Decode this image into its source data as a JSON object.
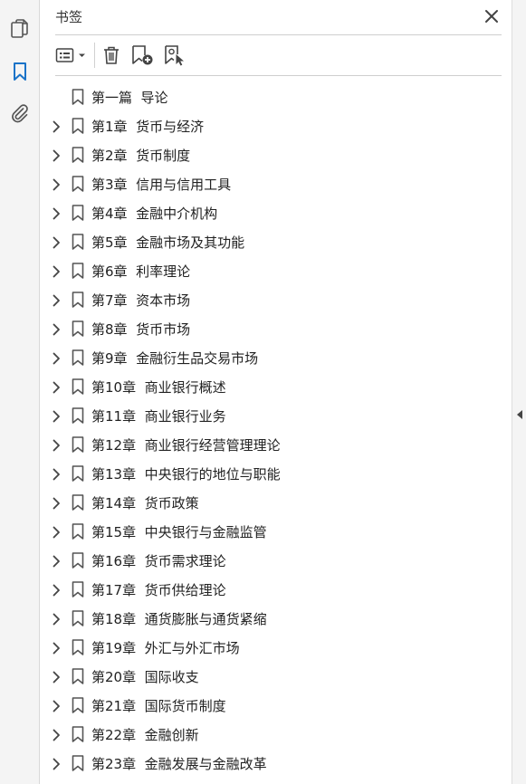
{
  "panel": {
    "title": "书签"
  },
  "rail": {
    "icons": [
      "pages-icon",
      "bookmark-icon",
      "attachment-icon"
    ],
    "active": "bookmark-icon"
  },
  "toolbar": {
    "buttons": [
      "options-menu-icon",
      "delete-bookmark-icon",
      "new-bookmark-icon",
      "new-bookmark-from-structure-icon"
    ]
  },
  "colors": {
    "accent": "#1a73c8",
    "icon": "#555555",
    "text": "#222222"
  },
  "bookmarks": [
    {
      "label": "第一篇  导论",
      "expandable": false
    },
    {
      "label": "第1章  货币与经济",
      "expandable": true
    },
    {
      "label": "第2章  货币制度",
      "expandable": true
    },
    {
      "label": "第3章  信用与信用工具",
      "expandable": true
    },
    {
      "label": "第4章  金融中介机构",
      "expandable": true
    },
    {
      "label": "第5章  金融市场及其功能",
      "expandable": true
    },
    {
      "label": "第6章  利率理论",
      "expandable": true
    },
    {
      "label": "第7章  资本市场",
      "expandable": true
    },
    {
      "label": "第8章  货币市场",
      "expandable": true
    },
    {
      "label": "第9章  金融衍生品交易市场",
      "expandable": true
    },
    {
      "label": "第10章  商业银行概述",
      "expandable": true
    },
    {
      "label": "第11章  商业银行业务",
      "expandable": true
    },
    {
      "label": "第12章  商业银行经营管理理论",
      "expandable": true
    },
    {
      "label": "第13章  中央银行的地位与职能",
      "expandable": true
    },
    {
      "label": "第14章  货币政策",
      "expandable": true
    },
    {
      "label": "第15章  中央银行与金融监管",
      "expandable": true
    },
    {
      "label": "第16章  货币需求理论",
      "expandable": true
    },
    {
      "label": "第17章  货币供给理论",
      "expandable": true
    },
    {
      "label": "第18章  通货膨胀与通货紧缩",
      "expandable": true
    },
    {
      "label": "第19章  外汇与外汇市场",
      "expandable": true
    },
    {
      "label": "第20章  国际收支",
      "expandable": true
    },
    {
      "label": "第21章  国际货币制度",
      "expandable": true
    },
    {
      "label": "第22章  金融创新",
      "expandable": true
    },
    {
      "label": "第23章  金融发展与金融改革",
      "expandable": true
    }
  ]
}
